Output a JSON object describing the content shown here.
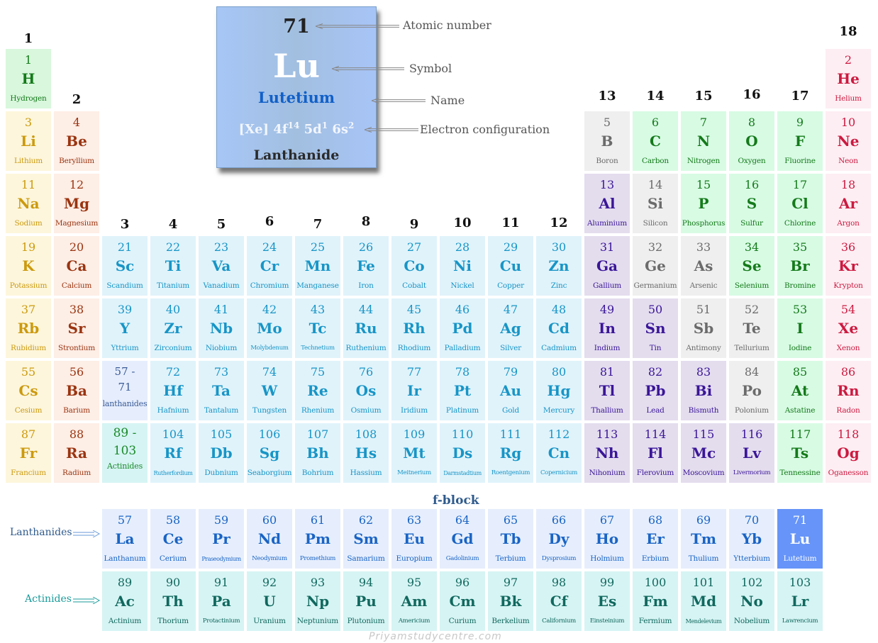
{
  "legend": {
    "atomic_number": "71",
    "symbol": "Lu",
    "name": "Lutetium",
    "config_base": "[Xe] 4f",
    "config_sup1": "14",
    "config_mid1": " 5d",
    "config_sup2": "1",
    "config_mid2": " 6s",
    "config_sup3": "2",
    "category": "Lanthanide",
    "callouts": {
      "atomic_number": "Atomic number",
      "symbol": "Symbol",
      "name": "Name",
      "electron_configuration": "Electron configuration"
    }
  },
  "groups": [
    "1",
    "2",
    "3",
    "4",
    "5",
    "6",
    "7",
    "8",
    "9",
    "10",
    "11",
    "12",
    "13",
    "14",
    "15",
    "16",
    "17",
    "18"
  ],
  "placeholders": {
    "lanthanides": {
      "range_a": "57 -",
      "range_b": "71",
      "label": "lanthanides"
    },
    "actinides": {
      "range_a": "89 -",
      "range_b": "103",
      "label": "Actinides"
    }
  },
  "fblock": {
    "title": "f-block",
    "lanthanides_label": "Lanthanides",
    "actinides_label": "Actinides"
  },
  "watermark": "Priyamstudycentre.com",
  "colors": {
    "highlight": "#6694f8",
    "transition_metal": "#e0f3fb",
    "post_transition": "#e4ddee",
    "nonmetal": "#d8fbe4",
    "noble_gas": "#fdeef3",
    "alkali": "#fdf6dc",
    "alkaline_earth": "#fdeee6",
    "metalloid": "#efefef",
    "lanthanide": "#e6eefd",
    "actinide": "#d6f4f4"
  },
  "elements": [
    {
      "n": "1",
      "s": "H",
      "name": "Hydrogen",
      "cat": "h",
      "col": 1,
      "row": 1
    },
    {
      "n": "2",
      "s": "He",
      "name": "Helium",
      "cat": "ng",
      "col": 18,
      "row": 1
    },
    {
      "n": "3",
      "s": "Li",
      "name": "Lithium",
      "cat": "alk",
      "col": 1,
      "row": 2
    },
    {
      "n": "4",
      "s": "Be",
      "name": "Beryllium",
      "cat": "ae",
      "col": 2,
      "row": 2
    },
    {
      "n": "5",
      "s": "B",
      "name": "Boron",
      "cat": "md",
      "col": 13,
      "row": 2
    },
    {
      "n": "6",
      "s": "C",
      "name": "Carbon",
      "cat": "nm",
      "col": 14,
      "row": 2
    },
    {
      "n": "7",
      "s": "N",
      "name": "Nitrogen",
      "cat": "nm",
      "col": 15,
      "row": 2
    },
    {
      "n": "8",
      "s": "O",
      "name": "Oxygen",
      "cat": "nm",
      "col": 16,
      "row": 2
    },
    {
      "n": "9",
      "s": "F",
      "name": "Fluorine",
      "cat": "nm",
      "col": 17,
      "row": 2
    },
    {
      "n": "10",
      "s": "Ne",
      "name": "Neon",
      "cat": "ng",
      "col": 18,
      "row": 2
    },
    {
      "n": "11",
      "s": "Na",
      "name": "Sodium",
      "cat": "alk",
      "col": 1,
      "row": 3
    },
    {
      "n": "12",
      "s": "Mg",
      "name": "Magnesium",
      "cat": "ae",
      "col": 2,
      "row": 3
    },
    {
      "n": "13",
      "s": "Al",
      "name": "Aluminium",
      "cat": "pt",
      "col": 13,
      "row": 3
    },
    {
      "n": "14",
      "s": "Si",
      "name": "Silicon",
      "cat": "md",
      "col": 14,
      "row": 3
    },
    {
      "n": "15",
      "s": "P",
      "name": "Phosphorus",
      "cat": "nm",
      "col": 15,
      "row": 3
    },
    {
      "n": "16",
      "s": "S",
      "name": "Sulfur",
      "cat": "nm",
      "col": 16,
      "row": 3
    },
    {
      "n": "17",
      "s": "Cl",
      "name": "Chlorine",
      "cat": "nm",
      "col": 17,
      "row": 3
    },
    {
      "n": "18",
      "s": "Ar",
      "name": "Argon",
      "cat": "ng",
      "col": 18,
      "row": 3
    },
    {
      "n": "19",
      "s": "K",
      "name": "Potassium",
      "cat": "alk",
      "col": 1,
      "row": 4
    },
    {
      "n": "20",
      "s": "Ca",
      "name": "Calcium",
      "cat": "ae",
      "col": 2,
      "row": 4
    },
    {
      "n": "21",
      "s": "Sc",
      "name": "Scandium",
      "cat": "tm",
      "col": 3,
      "row": 4
    },
    {
      "n": "22",
      "s": "Ti",
      "name": "Titanium",
      "cat": "tm",
      "col": 4,
      "row": 4
    },
    {
      "n": "23",
      "s": "Va",
      "name": "Vanadium",
      "cat": "tm",
      "col": 5,
      "row": 4
    },
    {
      "n": "24",
      "s": "Cr",
      "name": "Chromium",
      "cat": "tm",
      "col": 6,
      "row": 4
    },
    {
      "n": "25",
      "s": "Mn",
      "name": "Manganese",
      "cat": "tm",
      "col": 7,
      "row": 4
    },
    {
      "n": "26",
      "s": "Fe",
      "name": "Iron",
      "cat": "tm",
      "col": 8,
      "row": 4
    },
    {
      "n": "27",
      "s": "Co",
      "name": "Cobalt",
      "cat": "tm",
      "col": 9,
      "row": 4
    },
    {
      "n": "28",
      "s": "Ni",
      "name": "Nickel",
      "cat": "tm",
      "col": 10,
      "row": 4
    },
    {
      "n": "29",
      "s": "Cu",
      "name": "Copper",
      "cat": "tm",
      "col": 11,
      "row": 4
    },
    {
      "n": "30",
      "s": "Zn",
      "name": "Zinc",
      "cat": "tm",
      "col": 12,
      "row": 4
    },
    {
      "n": "31",
      "s": "Ga",
      "name": "Gallium",
      "cat": "pt",
      "col": 13,
      "row": 4
    },
    {
      "n": "32",
      "s": "Ge",
      "name": "Germanium",
      "cat": "md",
      "col": 14,
      "row": 4
    },
    {
      "n": "33",
      "s": "As",
      "name": "Arsenic",
      "cat": "md",
      "col": 15,
      "row": 4
    },
    {
      "n": "34",
      "s": "Se",
      "name": "Selenium",
      "cat": "nm",
      "col": 16,
      "row": 4
    },
    {
      "n": "35",
      "s": "Br",
      "name": "Bromine",
      "cat": "nm",
      "col": 17,
      "row": 4
    },
    {
      "n": "36",
      "s": "Kr",
      "name": "Krypton",
      "cat": "ng",
      "col": 18,
      "row": 4
    },
    {
      "n": "37",
      "s": "Rb",
      "name": "Rubidium",
      "cat": "alk",
      "col": 1,
      "row": 5
    },
    {
      "n": "38",
      "s": "Sr",
      "name": "Strontium",
      "cat": "ae",
      "col": 2,
      "row": 5
    },
    {
      "n": "39",
      "s": "Y",
      "name": "Yttrium",
      "cat": "tm",
      "col": 3,
      "row": 5
    },
    {
      "n": "40",
      "s": "Zr",
      "name": "Zirconium",
      "cat": "tm",
      "col": 4,
      "row": 5
    },
    {
      "n": "41",
      "s": "Nb",
      "name": "Niobium",
      "cat": "tm",
      "col": 5,
      "row": 5
    },
    {
      "n": "42",
      "s": "Mo",
      "name": "Molybdenum",
      "cat": "tm",
      "col": 6,
      "row": 5,
      "sz": "small"
    },
    {
      "n": "43",
      "s": "Tc",
      "name": "Technetium",
      "cat": "tm",
      "col": 7,
      "row": 5,
      "sz": "small"
    },
    {
      "n": "44",
      "s": "Ru",
      "name": "Ruthenium",
      "cat": "tm",
      "col": 8,
      "row": 5
    },
    {
      "n": "45",
      "s": "Rh",
      "name": "Rhodium",
      "cat": "tm",
      "col": 9,
      "row": 5
    },
    {
      "n": "46",
      "s": "Pd",
      "name": "Palladium",
      "cat": "tm",
      "col": 10,
      "row": 5
    },
    {
      "n": "47",
      "s": "Ag",
      "name": "Silver",
      "cat": "tm",
      "col": 11,
      "row": 5
    },
    {
      "n": "48",
      "s": "Cd",
      "name": "Cadmium",
      "cat": "tm",
      "col": 12,
      "row": 5
    },
    {
      "n": "49",
      "s": "In",
      "name": "Indium",
      "cat": "pt",
      "col": 13,
      "row": 5
    },
    {
      "n": "50",
      "s": "Sn",
      "name": "Tin",
      "cat": "pt",
      "col": 14,
      "row": 5
    },
    {
      "n": "51",
      "s": "Sb",
      "name": "Antimony",
      "cat": "md",
      "col": 15,
      "row": 5
    },
    {
      "n": "52",
      "s": "Te",
      "name": "Tellurium",
      "cat": "md",
      "col": 16,
      "row": 5
    },
    {
      "n": "53",
      "s": "I",
      "name": "Iodine",
      "cat": "nm",
      "col": 17,
      "row": 5
    },
    {
      "n": "54",
      "s": "Xe",
      "name": "Xenon",
      "cat": "ng",
      "col": 18,
      "row": 5
    },
    {
      "n": "55",
      "s": "Cs",
      "name": "Cesium",
      "cat": "alk",
      "col": 1,
      "row": 6
    },
    {
      "n": "56",
      "s": "Ba",
      "name": "Barium",
      "cat": "ae",
      "col": 2,
      "row": 6
    },
    {
      "n": "72",
      "s": "Hf",
      "name": "Hafnium",
      "cat": "tm",
      "col": 4,
      "row": 6
    },
    {
      "n": "73",
      "s": "Ta",
      "name": "Tantalum",
      "cat": "tm",
      "col": 5,
      "row": 6
    },
    {
      "n": "74",
      "s": "W",
      "name": "Tungsten",
      "cat": "tm",
      "col": 6,
      "row": 6
    },
    {
      "n": "75",
      "s": "Re",
      "name": "Rhenium",
      "cat": "tm",
      "col": 7,
      "row": 6
    },
    {
      "n": "76",
      "s": "Os",
      "name": "Osmium",
      "cat": "tm",
      "col": 8,
      "row": 6
    },
    {
      "n": "77",
      "s": "Ir",
      "name": "Iridium",
      "cat": "tm",
      "col": 9,
      "row": 6
    },
    {
      "n": "78",
      "s": "Pt",
      "name": "Platinum",
      "cat": "tm",
      "col": 10,
      "row": 6
    },
    {
      "n": "79",
      "s": "Au",
      "name": "Gold",
      "cat": "tm",
      "col": 11,
      "row": 6
    },
    {
      "n": "80",
      "s": "Hg",
      "name": "Mercury",
      "cat": "tm",
      "col": 12,
      "row": 6
    },
    {
      "n": "81",
      "s": "Tl",
      "name": "Thallium",
      "cat": "pt",
      "col": 13,
      "row": 6
    },
    {
      "n": "82",
      "s": "Pb",
      "name": "Lead",
      "cat": "pt",
      "col": 14,
      "row": 6
    },
    {
      "n": "83",
      "s": "Bi",
      "name": "Bismuth",
      "cat": "pt",
      "col": 15,
      "row": 6
    },
    {
      "n": "84",
      "s": "Po",
      "name": "Polonium",
      "cat": "md",
      "col": 16,
      "row": 6
    },
    {
      "n": "85",
      "s": "At",
      "name": "Astatine",
      "cat": "nm",
      "col": 17,
      "row": 6
    },
    {
      "n": "86",
      "s": "Rn",
      "name": "Radon",
      "cat": "ng",
      "col": 18,
      "row": 6
    },
    {
      "n": "87",
      "s": "Fr",
      "name": "Francium",
      "cat": "alk",
      "col": 1,
      "row": 7
    },
    {
      "n": "88",
      "s": "Ra",
      "name": "Radium",
      "cat": "ae",
      "col": 2,
      "row": 7
    },
    {
      "n": "104",
      "s": "Rf",
      "name": "Rutherfordium",
      "cat": "tm",
      "col": 4,
      "row": 7,
      "sz": "xsmall"
    },
    {
      "n": "105",
      "s": "Db",
      "name": "Dubnium",
      "cat": "tm",
      "col": 5,
      "row": 7
    },
    {
      "n": "106",
      "s": "Sg",
      "name": "Seaborgium",
      "cat": "tm",
      "col": 6,
      "row": 7
    },
    {
      "n": "107",
      "s": "Bh",
      "name": "Bohrium",
      "cat": "tm",
      "col": 7,
      "row": 7
    },
    {
      "n": "108",
      "s": "Hs",
      "name": "Hassium",
      "cat": "tm",
      "col": 8,
      "row": 7
    },
    {
      "n": "109",
      "s": "Mt",
      "name": "Meitnerium",
      "cat": "tm",
      "col": 9,
      "row": 7,
      "sz": "small"
    },
    {
      "n": "110",
      "s": "Ds",
      "name": "Darmstadtium",
      "cat": "tm",
      "col": 10,
      "row": 7,
      "sz": "xsmall"
    },
    {
      "n": "111",
      "s": "Rg",
      "name": "Roentgenium",
      "cat": "tm",
      "col": 11,
      "row": 7,
      "sz": "small"
    },
    {
      "n": "112",
      "s": "Cn",
      "name": "Copernicium",
      "cat": "tm",
      "col": 12,
      "row": 7,
      "sz": "small"
    },
    {
      "n": "113",
      "s": "Nh",
      "name": "Nihonium",
      "cat": "pt",
      "col": 13,
      "row": 7
    },
    {
      "n": "114",
      "s": "Fl",
      "name": "Flerovium",
      "cat": "pt",
      "col": 14,
      "row": 7
    },
    {
      "n": "115",
      "s": "Mc",
      "name": "Moscovium",
      "cat": "pt",
      "col": 15,
      "row": 7
    },
    {
      "n": "116",
      "s": "Lv",
      "name": "Livermorium",
      "cat": "pt",
      "col": 16,
      "row": 7,
      "sz": "small"
    },
    {
      "n": "117",
      "s": "Ts",
      "name": "Tennessine",
      "cat": "nm",
      "col": 17,
      "row": 7
    },
    {
      "n": "118",
      "s": "Og",
      "name": "Oganesson",
      "cat": "ng",
      "col": 18,
      "row": 7
    },
    {
      "n": "57",
      "s": "La",
      "name": "Lanthanum",
      "cat": "la",
      "col": 3,
      "row": 9
    },
    {
      "n": "58",
      "s": "Ce",
      "name": "Cerium",
      "cat": "la",
      "col": 4,
      "row": 9
    },
    {
      "n": "59",
      "s": "Pr",
      "name": "Praseodymium",
      "cat": "la",
      "col": 5,
      "row": 9,
      "sz": "xsmall"
    },
    {
      "n": "60",
      "s": "Nd",
      "name": "Neodymium",
      "cat": "la",
      "col": 6,
      "row": 9,
      "sz": "small"
    },
    {
      "n": "61",
      "s": "Pm",
      "name": "Promethium",
      "cat": "la",
      "col": 7,
      "row": 9,
      "sz": "small"
    },
    {
      "n": "62",
      "s": "Sm",
      "name": "Samarium",
      "cat": "la",
      "col": 8,
      "row": 9
    },
    {
      "n": "63",
      "s": "Eu",
      "name": "Europium",
      "cat": "la",
      "col": 9,
      "row": 9
    },
    {
      "n": "64",
      "s": "Gd",
      "name": "Gadolinium",
      "cat": "la",
      "col": 10,
      "row": 9,
      "sz": "small"
    },
    {
      "n": "65",
      "s": "Tb",
      "name": "Terbium",
      "cat": "la",
      "col": 11,
      "row": 9
    },
    {
      "n": "66",
      "s": "Dy",
      "name": "Dysprosium",
      "cat": "la",
      "col": 12,
      "row": 9,
      "sz": "small"
    },
    {
      "n": "67",
      "s": "Ho",
      "name": "Holmium",
      "cat": "la",
      "col": 13,
      "row": 9
    },
    {
      "n": "68",
      "s": "Er",
      "name": "Erbium",
      "cat": "la",
      "col": 14,
      "row": 9
    },
    {
      "n": "69",
      "s": "Tm",
      "name": "Thulium",
      "cat": "la",
      "col": 15,
      "row": 9
    },
    {
      "n": "70",
      "s": "Yb",
      "name": "Ytterbium",
      "cat": "la",
      "col": 16,
      "row": 9
    },
    {
      "n": "71",
      "s": "Lu",
      "name": "Lutetium",
      "cat": "lu",
      "col": 17,
      "row": 9
    },
    {
      "n": "89",
      "s": "Ac",
      "name": "Actinium",
      "cat": "ac",
      "col": 3,
      "row": 10
    },
    {
      "n": "90",
      "s": "Th",
      "name": "Thorium",
      "cat": "ac",
      "col": 4,
      "row": 10
    },
    {
      "n": "91",
      "s": "Pa",
      "name": "Protactinium",
      "cat": "ac",
      "col": 5,
      "row": 10,
      "sz": "small"
    },
    {
      "n": "92",
      "s": "U",
      "name": "Uranium",
      "cat": "ac",
      "col": 6,
      "row": 10
    },
    {
      "n": "93",
      "s": "Np",
      "name": "Neptunium",
      "cat": "ac",
      "col": 7,
      "row": 10
    },
    {
      "n": "94",
      "s": "Pu",
      "name": "Plutonium",
      "cat": "ac",
      "col": 8,
      "row": 10
    },
    {
      "n": "95",
      "s": "Am",
      "name": "Americium",
      "cat": "ac",
      "col": 9,
      "row": 10,
      "sz": "small"
    },
    {
      "n": "96",
      "s": "Cm",
      "name": "Curium",
      "cat": "ac",
      "col": 10,
      "row": 10
    },
    {
      "n": "97",
      "s": "Bk",
      "name": "Berkelium",
      "cat": "ac",
      "col": 11,
      "row": 10
    },
    {
      "n": "98",
      "s": "Cf",
      "name": "Californium",
      "cat": "ac",
      "col": 12,
      "row": 10,
      "sz": "small"
    },
    {
      "n": "99",
      "s": "Es",
      "name": "Einsteinium",
      "cat": "ac",
      "col": 13,
      "row": 10,
      "sz": "small"
    },
    {
      "n": "100",
      "s": "Fm",
      "name": "Fermium",
      "cat": "ac",
      "col": 14,
      "row": 10
    },
    {
      "n": "101",
      "s": "Md",
      "name": "Mendelevium",
      "cat": "ac",
      "col": 15,
      "row": 10,
      "sz": "xsmall"
    },
    {
      "n": "102",
      "s": "No",
      "name": "Nobelium",
      "cat": "ac",
      "col": 16,
      "row": 10
    },
    {
      "n": "103",
      "s": "Lr",
      "name": "Lawrencium",
      "cat": "ac",
      "col": 17,
      "row": 10,
      "sz": "small"
    }
  ]
}
